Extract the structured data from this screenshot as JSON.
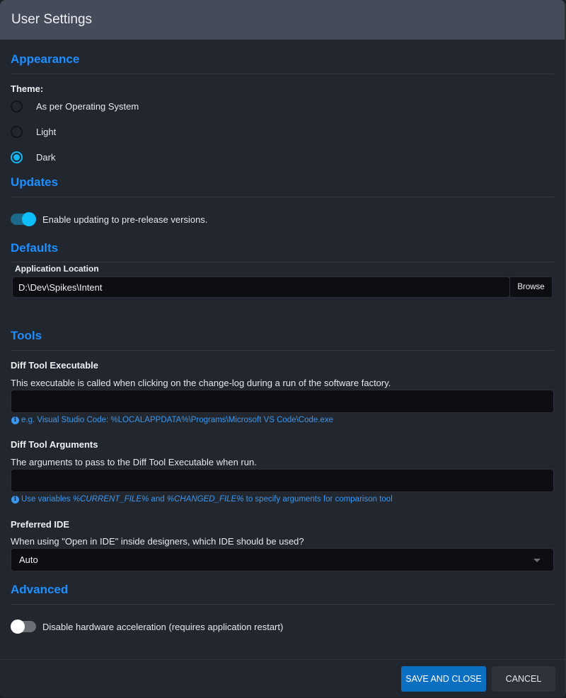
{
  "dialog": {
    "title": "User Settings"
  },
  "appearance": {
    "title": "Appearance",
    "theme_label": "Theme:",
    "options": [
      {
        "label": "As per Operating System",
        "selected": false
      },
      {
        "label": "Light",
        "selected": false
      },
      {
        "label": "Dark",
        "selected": true
      }
    ]
  },
  "updates": {
    "title": "Updates",
    "prerelease_label": "Enable updating to pre-release versions.",
    "prerelease_enabled": true
  },
  "defaults": {
    "title": "Defaults",
    "app_location_label": "Application Location",
    "app_location_value": "D:\\Dev\\Spikes\\Intent",
    "browse_label": "Browse"
  },
  "tools": {
    "title": "Tools",
    "diff_exe": {
      "label": "Diff Tool Executable",
      "description": "This executable is called when clicking on the change-log during a run of the software factory.",
      "value": "",
      "hint": "e.g. Visual Studio Code: %LOCALAPPDATA%\\Programs\\Microsoft VS Code\\Code.exe"
    },
    "diff_args": {
      "label": "Diff Tool Arguments",
      "description": "The arguments to pass to the Diff Tool Executable when run.",
      "value": "",
      "hint_prefix": "Use variables ",
      "hint_var1": "%CURRENT_FILE%",
      "hint_mid": " and ",
      "hint_var2": "%CHANGED_FILE%",
      "hint_suffix": " to specify arguments for comparison tool"
    },
    "ide": {
      "label": "Preferred IDE",
      "description": "When using \"Open in IDE\" inside designers, which IDE should be used?",
      "selected": "Auto"
    }
  },
  "advanced": {
    "title": "Advanced",
    "hw_accel_label": "Disable hardware acceleration (requires application restart)",
    "hw_accel_disabled": false
  },
  "footer": {
    "save_label": "SAVE AND CLOSE",
    "cancel_label": "CANCEL"
  },
  "colors": {
    "accent": "#1e8fff",
    "primary_button": "#0b6fc2",
    "toggle_on": "#0ebef8"
  }
}
